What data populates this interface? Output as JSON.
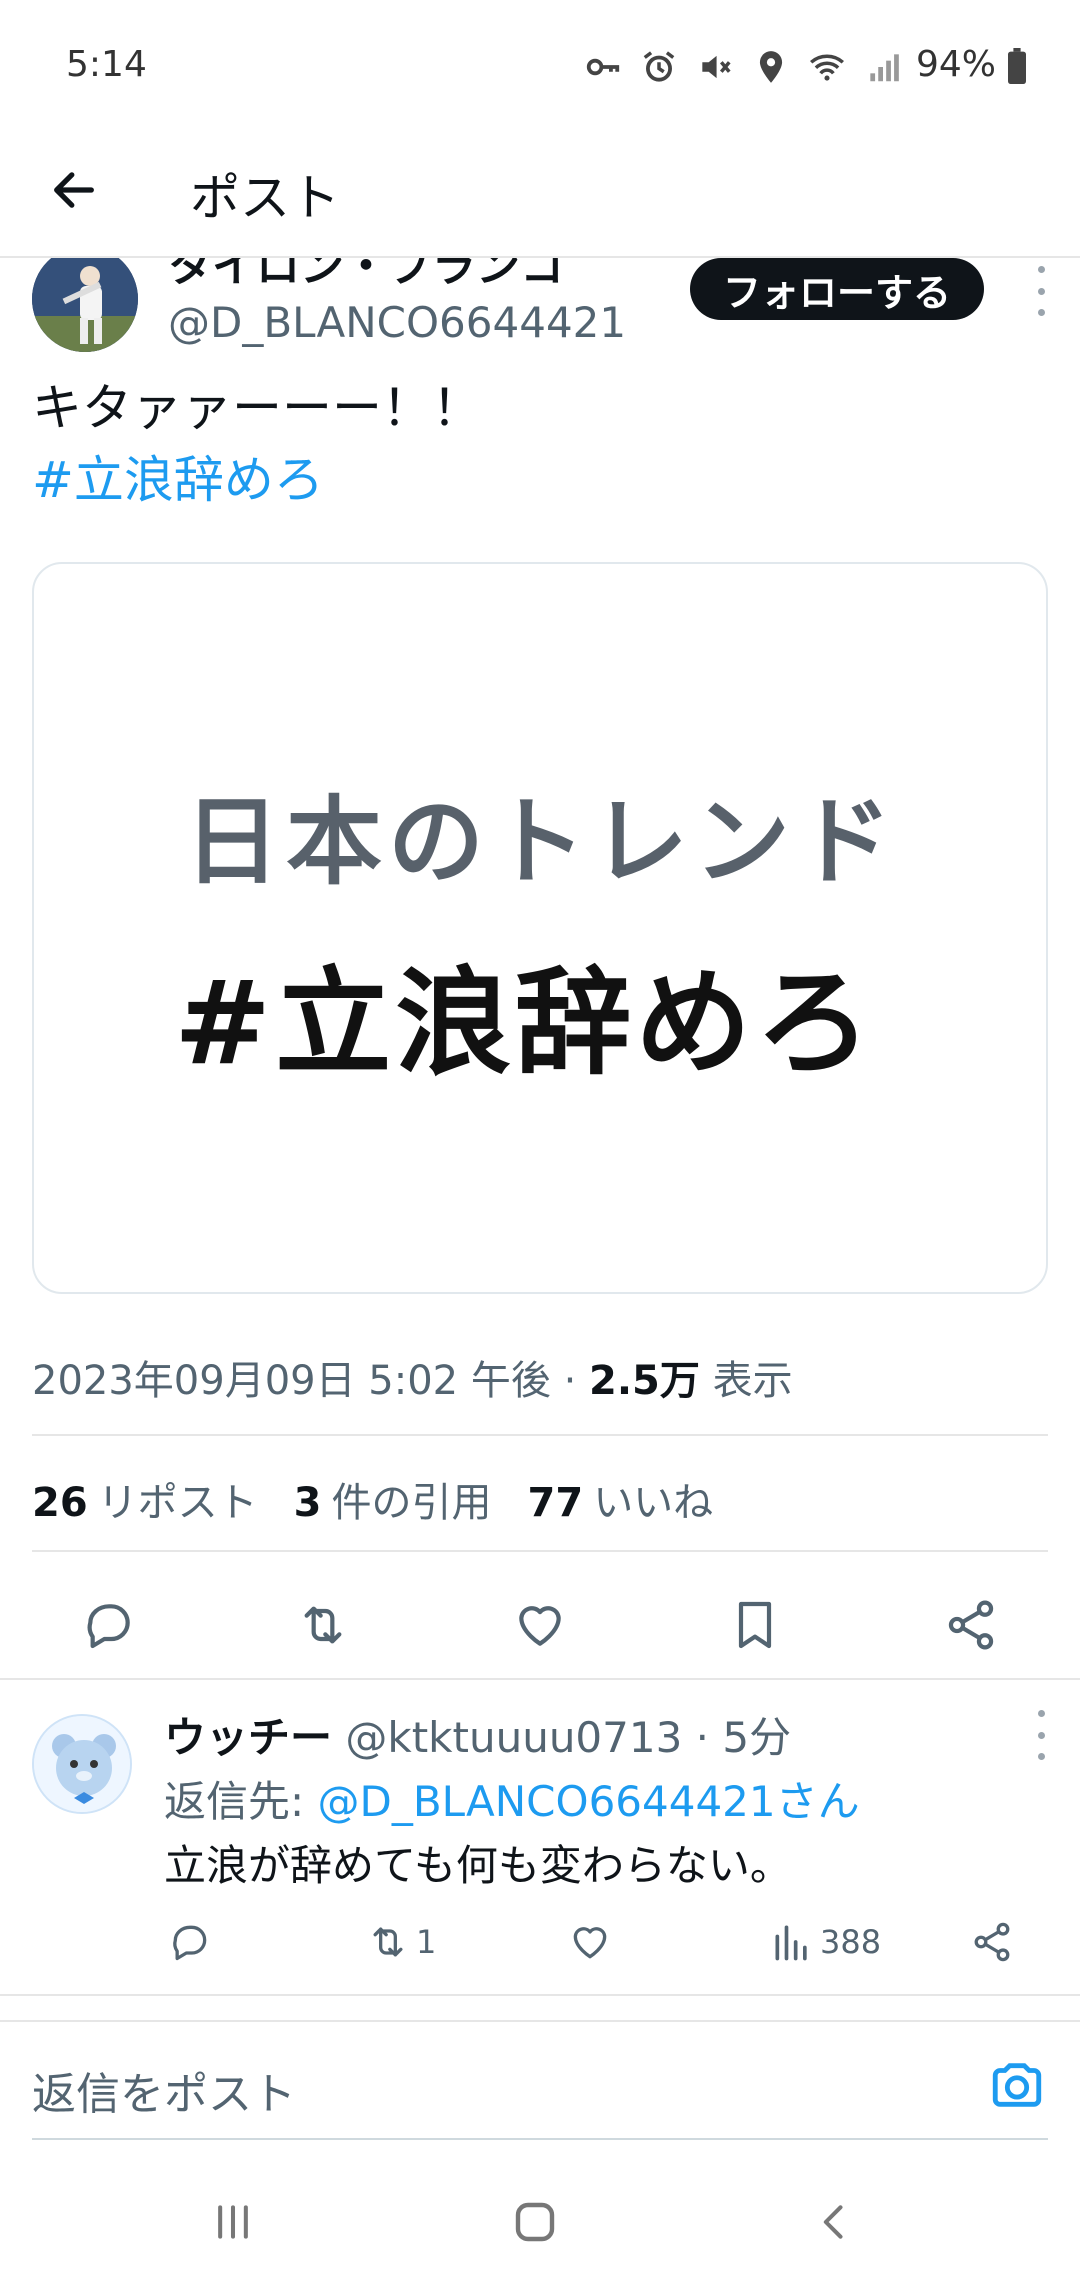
{
  "status_bar": {
    "time": "5:14",
    "battery": "94%",
    "icons": [
      "vpn-key-icon",
      "alarm-icon",
      "mute-icon",
      "location-icon",
      "wifi-icon",
      "signal-icon",
      "battery-icon"
    ]
  },
  "header": {
    "title": "ポスト"
  },
  "post": {
    "author_name": "タイロン・ブランコ",
    "author_handle": "@D_BLANCO6644421",
    "follow_label": "フォローする",
    "text": "キタァァーーー！！",
    "hashtag": "#立浪辞めろ",
    "media": {
      "line1": "日本のトレンド",
      "line2": "#立浪辞めろ"
    },
    "timestamp": "2023年09月09日 5:02 午後",
    "views_count": "2.5万",
    "views_label": "表示",
    "separator": "·",
    "stats": {
      "reposts_count": "26",
      "reposts_label": "リポスト",
      "quotes_count": "3",
      "quotes_label": "件の引用",
      "likes_count": "77",
      "likes_label": "いいね"
    }
  },
  "reply": {
    "name": "ウッチー",
    "handle_time": "@ktktuuuu0713 · 5分",
    "reply_to_label": "返信先:",
    "reply_to_mention": "@D_BLANCO6644421さん",
    "text": "立浪が辞めても何も変わらない。",
    "retweet_count": "1",
    "views_count": "388"
  },
  "composer": {
    "placeholder": "返信をポスト"
  },
  "colors": {
    "accent": "#1d9bf0",
    "text": "#0f1419",
    "secondary": "#536471"
  }
}
